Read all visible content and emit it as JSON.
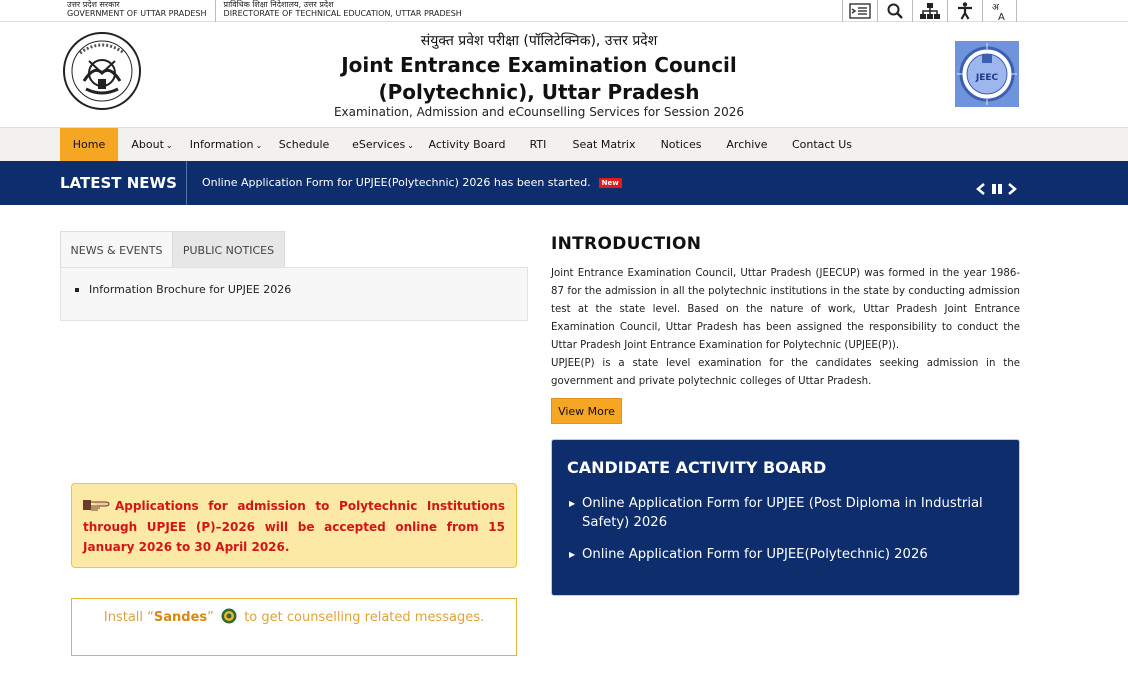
{
  "topbar": {
    "gov_hi": "उत्तर प्रदेश सरकार",
    "gov_en": "GOVERNMENT OF UTTAR PRADESH",
    "dte_hi": "प्राविधिक शिक्षा निदेशालय, उत्तर प्रदेश",
    "dte_en": "DIRECTORATE OF TECHNICAL EDUCATION, UTTAR PRADESH",
    "tools": [
      "skip-to-content-icon",
      "search-icon",
      "sitemap-icon",
      "accessibility-icon",
      "language-icon"
    ]
  },
  "header": {
    "hindi_title": "संयुक्त प्रवेश परीक्षा (पॉलिटेक्निक), उत्तर प्रदेश",
    "title_line1": "Joint Entrance Examination Council",
    "title_line2": "(Polytechnic), Uttar Pradesh",
    "subtitle": "Examination, Admission and eCounselling Services for Session 2026",
    "logo_text": "JEEC"
  },
  "nav": {
    "items": [
      {
        "label": "Home",
        "active": true
      },
      {
        "label": "About",
        "dropdown": true
      },
      {
        "label": "Information",
        "dropdown": true
      },
      {
        "label": "Schedule"
      },
      {
        "label": "eServices",
        "dropdown": true
      },
      {
        "label": "Activity Board"
      },
      {
        "label": "RTI"
      },
      {
        "label": "Seat Matrix"
      },
      {
        "label": "Notices"
      },
      {
        "label": "Archive"
      },
      {
        "label": "Contact Us"
      }
    ]
  },
  "news": {
    "label": "LATEST NEWS",
    "text": "Online Application Form for UPJEE(Polytechnic) 2026 has been started.",
    "badge": "New"
  },
  "tabs": {
    "tab1": "NEWS & EVENTS",
    "tab2": "PUBLIC NOTICES",
    "items": [
      "Information Brochure for UPJEE 2026"
    ]
  },
  "notice": {
    "admission": "Applications for admission to Polytechnic Institutions through UPJEE (P)–2026 will be accepted online from 15 January 2026 to 30 April 2026.",
    "sandes_prefix": "Install “",
    "sandes_name": "Sandes",
    "sandes_quote": "”",
    "sandes_suffix": "to get counselling related messages."
  },
  "intro": {
    "title": "INTRODUCTION",
    "para1": "Joint Entrance Examination Council, Uttar Pradesh (JEECUP) was formed in the year 1986-87 for the admission in all the polytechnic institutions in the state by conducting admission test at the state level. Based on the nature of work, Uttar Pradesh Joint Entrance Examination Council, Uttar Pradesh has been assigned the responsibility to conduct the Uttar Pradesh Joint Entrance Examination for Polytechnic (UPJEE(P)).",
    "para2": "UPJEE(P) is a state level examination for the candidates seeking admission in the government and private polytechnic colleges of Uttar Pradesh.",
    "view_more": "View More"
  },
  "board": {
    "title": "CANDIDATE ACTIVITY BOARD",
    "items": [
      "Online Application Form for UPJEE (Post Diploma in Industrial Safety) 2026",
      "Online Application Form for UPJEE(Polytechnic) 2026"
    ]
  },
  "colors": {
    "navy": "#0d2d6c",
    "accent": "#f5a623",
    "notice_red": "#d41515"
  }
}
